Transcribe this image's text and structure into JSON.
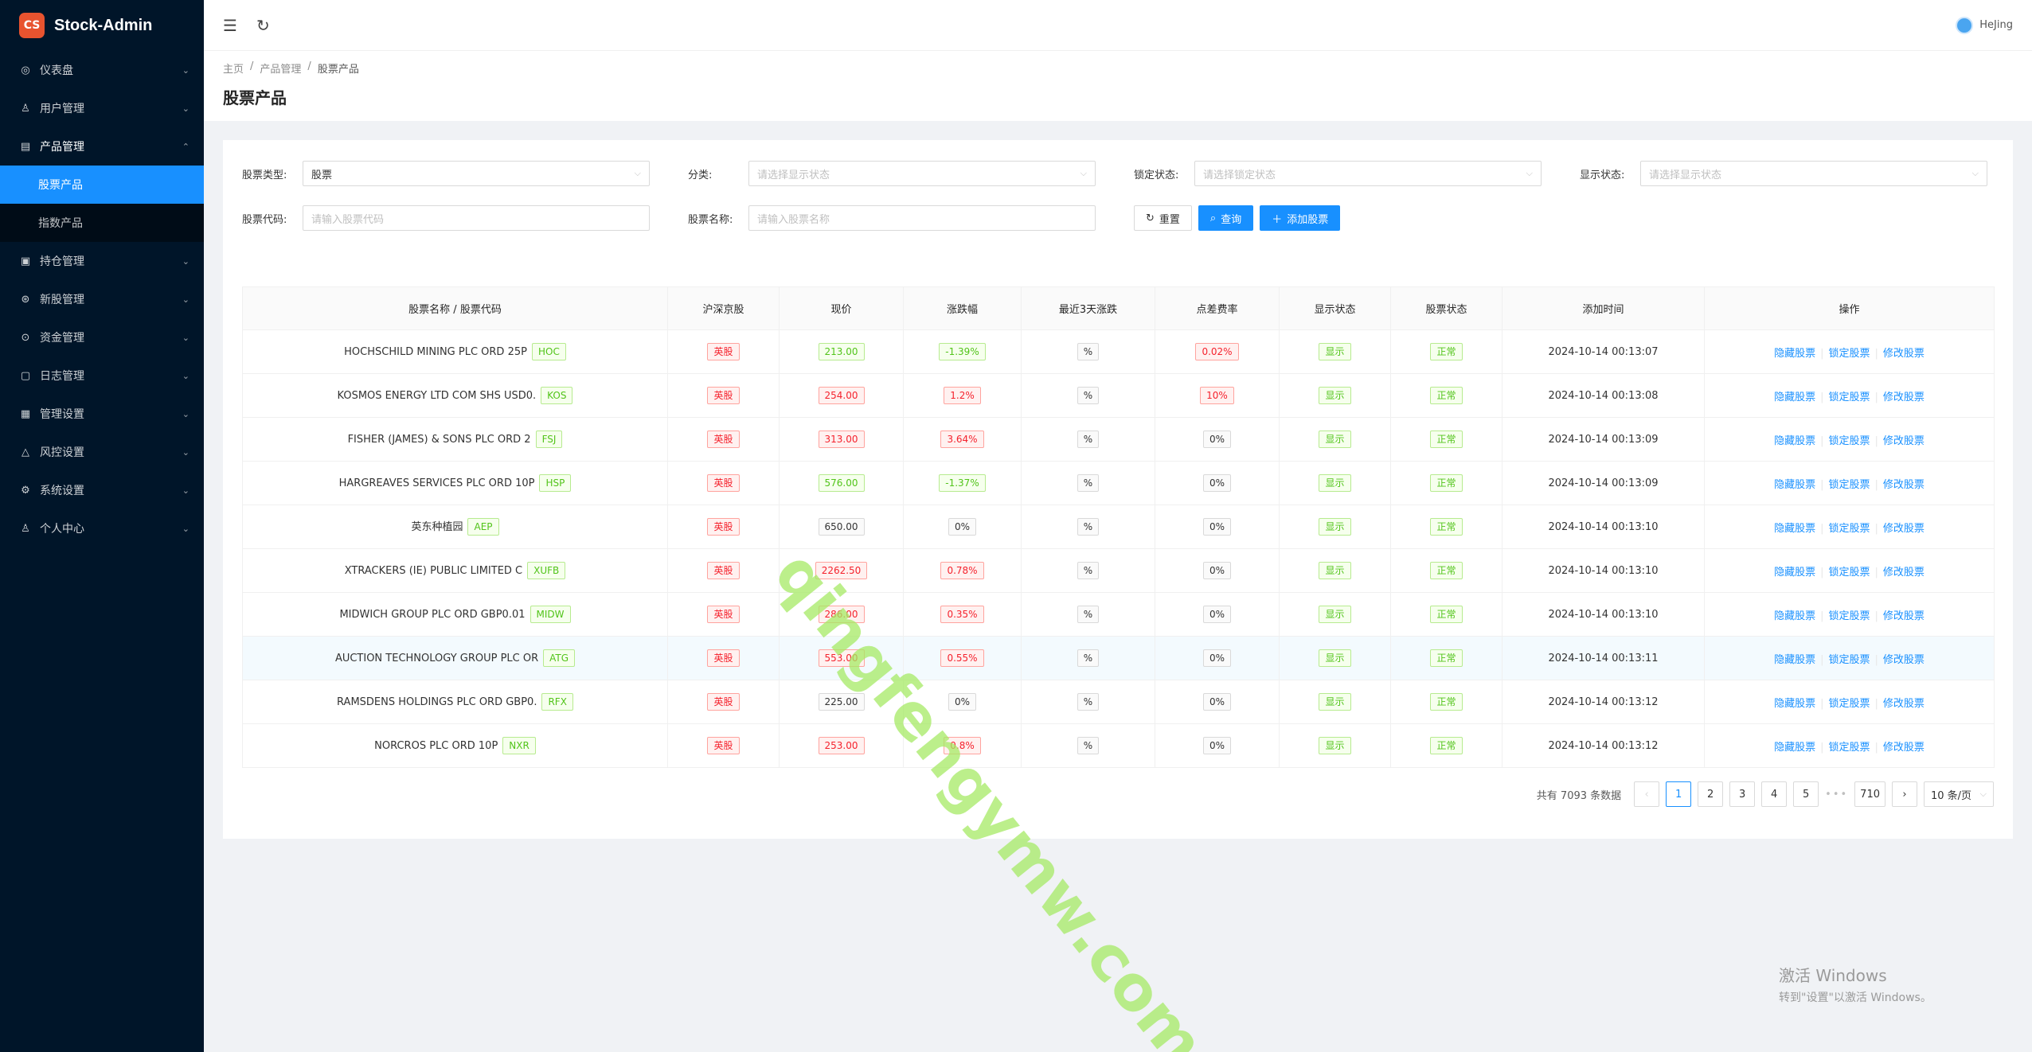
{
  "app": {
    "logo_text": "Stock-Admin",
    "logo_glyph": "CS"
  },
  "sidebar": {
    "items": [
      {
        "label": "仪表盘",
        "icon": "dashboard-icon",
        "glyph": "◎"
      },
      {
        "label": "用户管理",
        "icon": "users-icon",
        "glyph": "♙"
      },
      {
        "label": "产品管理",
        "icon": "chart-icon",
        "glyph": "▤",
        "open": true,
        "children": [
          {
            "label": "股票产品",
            "active": true
          },
          {
            "label": "指数产品"
          }
        ]
      },
      {
        "label": "持仓管理",
        "icon": "holdings-icon",
        "glyph": "▣"
      },
      {
        "label": "新股管理",
        "icon": "ipo-icon",
        "glyph": "⊛"
      },
      {
        "label": "资金管理",
        "icon": "money-icon",
        "glyph": "⊙"
      },
      {
        "label": "日志管理",
        "icon": "log-icon",
        "glyph": "▢"
      },
      {
        "label": "管理设置",
        "icon": "admin-settings-icon",
        "glyph": "▦"
      },
      {
        "label": "风控设置",
        "icon": "warning-icon",
        "glyph": "△"
      },
      {
        "label": "系统设置",
        "icon": "settings-icon",
        "glyph": "⚙"
      },
      {
        "label": "个人中心",
        "icon": "user-icon",
        "glyph": "♙"
      }
    ]
  },
  "header": {
    "user_name": "HeJing"
  },
  "breadcrumb": [
    "主页",
    "产品管理",
    "股票产品"
  ],
  "page_title": "股票产品",
  "filters": {
    "stock_type": {
      "label": "股票类型:",
      "value": "股票"
    },
    "category": {
      "label": "分类:",
      "placeholder": "请选择显示状态"
    },
    "lock_status": {
      "label": "锁定状态:",
      "placeholder": "请选择锁定状态"
    },
    "display_status": {
      "label": "显示状态:",
      "placeholder": "请选择显示状态"
    },
    "stock_code": {
      "label": "股票代码:",
      "placeholder": "请输入股票代码"
    },
    "stock_name": {
      "label": "股票名称:",
      "placeholder": "请输入股票名称"
    },
    "reset_label": "重置",
    "search_label": "查询",
    "add_label": "添加股票"
  },
  "table": {
    "columns": [
      "股票名称 / 股票代码",
      "沪深京股",
      "现价",
      "涨跌幅",
      "最近3天涨跌",
      "点差费率",
      "显示状态",
      "股票状态",
      "添加时间",
      "操作"
    ],
    "actions": [
      "隐藏股票",
      "锁定股票",
      "修改股票"
    ],
    "rows": [
      {
        "name": "HOCHSCHILD MINING PLC ORD 25P",
        "code": "HOC",
        "market": "英股",
        "price": "213.00",
        "price_tone": "green",
        "change": "-1.39%",
        "change_tone": "green",
        "three_day": "%",
        "spread": "0.02%",
        "spread_tone": "red",
        "display": "显示",
        "status": "正常",
        "time": "2024-10-14 00:13:07"
      },
      {
        "name": "KOSMOS ENERGY LTD COM SHS USD0.",
        "code": "KOS",
        "market": "英股",
        "price": "254.00",
        "price_tone": "red",
        "change": "1.2%",
        "change_tone": "red",
        "three_day": "%",
        "spread": "10%",
        "spread_tone": "red",
        "display": "显示",
        "status": "正常",
        "time": "2024-10-14 00:13:08"
      },
      {
        "name": "FISHER (JAMES) & SONS PLC ORD 2",
        "code": "FSJ",
        "market": "英股",
        "price": "313.00",
        "price_tone": "red",
        "change": "3.64%",
        "change_tone": "red",
        "three_day": "%",
        "spread": "0%",
        "spread_tone": "gray",
        "display": "显示",
        "status": "正常",
        "time": "2024-10-14 00:13:09"
      },
      {
        "name": "HARGREAVES SERVICES PLC ORD 10P",
        "code": "HSP",
        "market": "英股",
        "price": "576.00",
        "price_tone": "green",
        "change": "-1.37%",
        "change_tone": "green",
        "three_day": "%",
        "spread": "0%",
        "spread_tone": "gray",
        "display": "显示",
        "status": "正常",
        "time": "2024-10-14 00:13:09"
      },
      {
        "name": "英东种植园",
        "code": "AEP",
        "market": "英股",
        "price": "650.00",
        "price_tone": "gray",
        "change": "0%",
        "change_tone": "gray",
        "three_day": "%",
        "spread": "0%",
        "spread_tone": "gray",
        "display": "显示",
        "status": "正常",
        "time": "2024-10-14 00:13:10"
      },
      {
        "name": "XTRACKERS (IE) PUBLIC LIMITED C",
        "code": "XUFB",
        "market": "英股",
        "price": "2262.50",
        "price_tone": "red",
        "change": "0.78%",
        "change_tone": "red",
        "three_day": "%",
        "spread": "0%",
        "spread_tone": "gray",
        "display": "显示",
        "status": "正常",
        "time": "2024-10-14 00:13:10"
      },
      {
        "name": "MIDWICH GROUP PLC ORD GBP0.01",
        "code": "MIDW",
        "market": "英股",
        "price": "286.00",
        "price_tone": "red",
        "change": "0.35%",
        "change_tone": "red",
        "three_day": "%",
        "spread": "0%",
        "spread_tone": "gray",
        "display": "显示",
        "status": "正常",
        "time": "2024-10-14 00:13:10"
      },
      {
        "name": "AUCTION TECHNOLOGY GROUP PLC OR",
        "code": "ATG",
        "market": "英股",
        "price": "553.00",
        "price_tone": "red",
        "change": "0.55%",
        "change_tone": "red",
        "three_day": "%",
        "spread": "0%",
        "spread_tone": "gray",
        "display": "显示",
        "status": "正常",
        "time": "2024-10-14 00:13:11",
        "highlight": true
      },
      {
        "name": "RAMSDENS HOLDINGS PLC ORD GBP0.",
        "code": "RFX",
        "market": "英股",
        "price": "225.00",
        "price_tone": "gray",
        "change": "0%",
        "change_tone": "gray",
        "three_day": "%",
        "spread": "0%",
        "spread_tone": "gray",
        "display": "显示",
        "status": "正常",
        "time": "2024-10-14 00:13:12"
      },
      {
        "name": "NORCROS PLC ORD 10P",
        "code": "NXR",
        "market": "英股",
        "price": "253.00",
        "price_tone": "red",
        "change": "0.8%",
        "change_tone": "red",
        "three_day": "%",
        "spread": "0%",
        "spread_tone": "gray",
        "display": "显示",
        "status": "正常",
        "time": "2024-10-14 00:13:12"
      }
    ]
  },
  "pagination": {
    "total_text": "共有 7093 条数据",
    "pages": [
      "1",
      "2",
      "3",
      "4",
      "5"
    ],
    "current": "1",
    "dots": "•••",
    "last_page": "710",
    "page_size": "10 条/页"
  },
  "watermark": "qingfengymw.com",
  "windows_activation": {
    "line1": "激活 Windows",
    "line2": "转到\"设置\"以激活 Windows。"
  },
  "colors": {
    "sidebar_bg": "#001529",
    "accent": "#1890ff",
    "red": "#f5222d",
    "green": "#52c41a"
  }
}
